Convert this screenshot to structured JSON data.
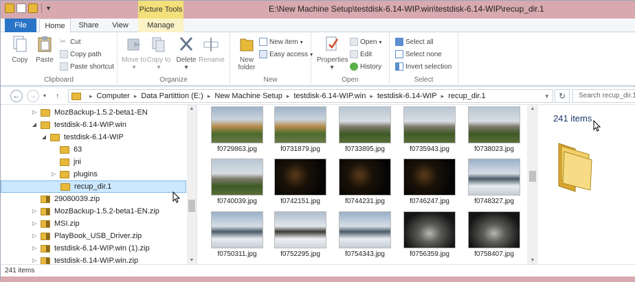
{
  "window": {
    "title": "E:\\New Machine Setup\\testdisk-6.14-WIP.win\\testdisk-6.14-WIP\\recup_dir.1",
    "contextual_tab_group": "Picture Tools"
  },
  "tabs": [
    "File",
    "Home",
    "Share",
    "View",
    "Manage"
  ],
  "ribbon": {
    "clipboard": {
      "label": "Clipboard",
      "copy": "Copy",
      "paste": "Paste",
      "cut": "Cut",
      "copy_path": "Copy path",
      "paste_shortcut": "Paste shortcut"
    },
    "organize": {
      "label": "Organize",
      "move_to": "Move to",
      "copy_to": "Copy to",
      "delete": "Delete",
      "rename": "Rename"
    },
    "new": {
      "label": "New",
      "new_folder": "New folder",
      "new_item": "New item",
      "easy_access": "Easy access"
    },
    "open": {
      "label": "Open",
      "properties": "Properties",
      "open": "Open",
      "edit": "Edit",
      "history": "History"
    },
    "select": {
      "label": "Select",
      "select_all": "Select all",
      "select_none": "Select none",
      "invert_selection": "Invert selection"
    }
  },
  "address": {
    "crumbs": [
      "Computer",
      "Data Partittion (E:)",
      "New Machine Setup",
      "testdisk-6.14-WIP.win",
      "testdisk-6.14-WIP",
      "recup_dir.1"
    ],
    "search_placeholder": "Search recup_dir.1"
  },
  "nav_tree": [
    {
      "label": "MozBackup-1.5.2-beta1-EN",
      "indent": 1,
      "expander": "collapsed",
      "icon": "folder-icon"
    },
    {
      "label": "testdisk-6.14-WIP.win",
      "indent": 1,
      "expander": "expanded",
      "icon": "folder-icon"
    },
    {
      "label": "testdisk-6.14-WIP",
      "indent": 2,
      "expander": "expanded",
      "icon": "folder-icon"
    },
    {
      "label": "63",
      "indent": 3,
      "expander": "none",
      "icon": "folder-icon"
    },
    {
      "label": "jni",
      "indent": 3,
      "expander": "none",
      "icon": "folder-icon"
    },
    {
      "label": "plugins",
      "indent": 3,
      "expander": "collapsed",
      "icon": "folder-icon"
    },
    {
      "label": "recup_dir.1",
      "indent": 3,
      "expander": "none",
      "icon": "folder-icon",
      "selected": true
    },
    {
      "label": "29080039.zip",
      "indent": 1,
      "expander": "none",
      "icon": "zip-folder-icon"
    },
    {
      "label": "MozBackup-1.5.2-beta1-EN.zip",
      "indent": 1,
      "expander": "collapsed",
      "icon": "zip-folder-icon"
    },
    {
      "label": "MSI.zip",
      "indent": 1,
      "expander": "collapsed",
      "icon": "zip-folder-icon"
    },
    {
      "label": "PlayBook_USB_Driver.zip",
      "indent": 1,
      "expander": "collapsed",
      "icon": "zip-folder-icon"
    },
    {
      "label": "testdisk-6.14-WIP.win (1).zip",
      "indent": 1,
      "expander": "collapsed",
      "icon": "zip-folder-icon"
    },
    {
      "label": "testdisk-6.14-WIP.win.zip",
      "indent": 1,
      "expander": "collapsed",
      "icon": "zip-folder-icon"
    }
  ],
  "files": [
    {
      "name": "f0729863.jpg",
      "scene": "house-day"
    },
    {
      "name": "f0731879.jpg",
      "scene": "house-day"
    },
    {
      "name": "f0733895.jpg",
      "scene": "yard-day"
    },
    {
      "name": "f0735943.jpg",
      "scene": "yard-day"
    },
    {
      "name": "f0738023.jpg",
      "scene": "yard-day"
    },
    {
      "name": "f0740039.jpg",
      "scene": "yard-day"
    },
    {
      "name": "f0742151.jpg",
      "scene": "night"
    },
    {
      "name": "f0744231.jpg",
      "scene": "night"
    },
    {
      "name": "f0746247.jpg",
      "scene": "night"
    },
    {
      "name": "f0748327.jpg",
      "scene": "snow-lake"
    },
    {
      "name": "f0750311.jpg",
      "scene": "snow-lake"
    },
    {
      "name": "f0752295.jpg",
      "scene": "snow-trees"
    },
    {
      "name": "f0754343.jpg",
      "scene": "snow-lake"
    },
    {
      "name": "f0756359.jpg",
      "scene": "car-night"
    },
    {
      "name": "f0758407.jpg",
      "scene": "car-night"
    }
  ],
  "details": {
    "count": "241 items"
  },
  "status": {
    "count": "241 items"
  },
  "colors": {
    "title_bar": "#d8a9ae",
    "picture_tools": "#f4e07a",
    "file_tab": "#2a74c8",
    "selection": "#cce8ff",
    "folder": "#e8b83a"
  }
}
